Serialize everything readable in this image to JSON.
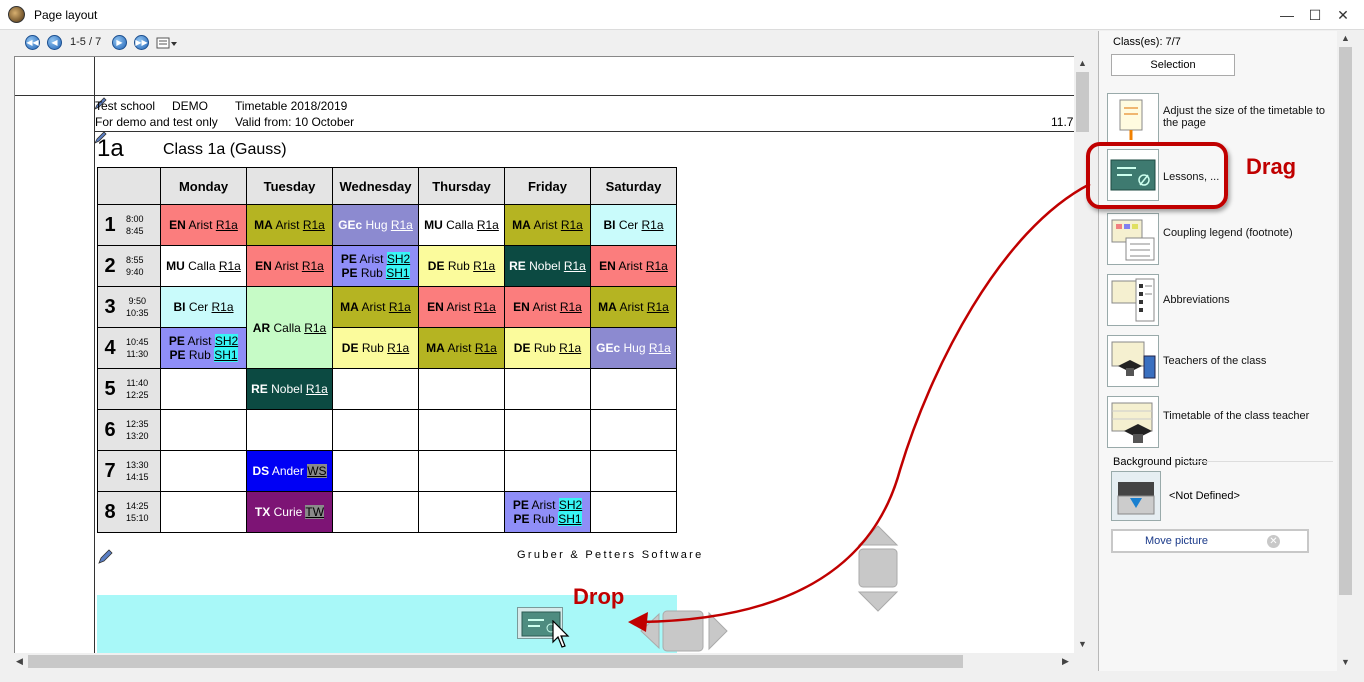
{
  "window": {
    "title": "Page layout"
  },
  "toolbar": {
    "page_info": "1-5 / 7"
  },
  "header": {
    "school": "Test school",
    "demo": "DEMO",
    "timetable": "Timetable 2018/2019",
    "note": "For demo and test only",
    "valid_from": "Valid from: 10 October",
    "right_number": "11.7"
  },
  "klass": {
    "code": "1a",
    "name": "Class 1a (Gauss)"
  },
  "days": [
    "Monday",
    "Tuesday",
    "Wednesday",
    "Thursday",
    "Friday",
    "Saturday"
  ],
  "hours": [
    {
      "n": "1",
      "t1": "8:00",
      "t2": "8:45"
    },
    {
      "n": "2",
      "t1": "8:55",
      "t2": "9:40"
    },
    {
      "n": "3",
      "t1": "9:50",
      "t2": "10:35"
    },
    {
      "n": "4",
      "t1": "10:45",
      "t2": "11:30"
    },
    {
      "n": "5",
      "t1": "11:40",
      "t2": "12:25"
    },
    {
      "n": "6",
      "t1": "12:35",
      "t2": "13:20"
    },
    {
      "n": "7",
      "t1": "13:30",
      "t2": "14:15"
    },
    {
      "n": "8",
      "t1": "14:25",
      "t2": "15:10"
    }
  ],
  "lessons": {
    "r1": [
      {
        "s": "EN",
        "t": "Arist",
        "r": "R1a"
      },
      {
        "s": "MA",
        "t": "Arist",
        "r": "R1a"
      },
      {
        "s": "GEc",
        "t": "Hug",
        "r": "R1a"
      },
      {
        "s": "MU",
        "t": "Calla",
        "r": "R1a"
      },
      {
        "s": "MA",
        "t": "Arist",
        "r": "R1a"
      },
      {
        "s": "BI",
        "t": "Cer",
        "r": "R1a"
      }
    ],
    "r2": [
      {
        "s": "MU",
        "t": "Calla",
        "r": "R1a"
      },
      {
        "s": "EN",
        "t": "Arist",
        "r": "R1a"
      },
      {
        "s": "PE",
        "t": "Arist",
        "r": "SH2",
        "s2": "PE",
        "t2": "Rub",
        "r2": "SH1"
      },
      {
        "s": "DE",
        "t": "Rub",
        "r": "R1a"
      },
      {
        "s": "RE",
        "t": "Nobel",
        "r": "R1a"
      },
      {
        "s": "EN",
        "t": "Arist",
        "r": "R1a"
      }
    ],
    "r3": [
      {
        "s": "BI",
        "t": "Cer",
        "r": "R1a"
      },
      {
        "s": "AR",
        "t": "Calla",
        "r": "R1a"
      },
      {
        "s": "MA",
        "t": "Arist",
        "r": "R1a"
      },
      {
        "s": "EN",
        "t": "Arist",
        "r": "R1a"
      },
      {
        "s": "EN",
        "t": "Arist",
        "r": "R1a"
      },
      {
        "s": "MA",
        "t": "Arist",
        "r": "R1a"
      }
    ],
    "r4": [
      {
        "s": "PE",
        "t": "Arist",
        "r": "SH2",
        "s2": "PE",
        "t2": "Rub",
        "r2": "SH1"
      },
      {
        "s": "DE",
        "t": "Rub",
        "r": "R1a"
      },
      {
        "s": "MA",
        "t": "Arist",
        "r": "R1a"
      },
      {
        "s": "DE",
        "t": "Rub",
        "r": "R1a"
      },
      {
        "s": "GEc",
        "t": "Hug",
        "r": "R1a"
      }
    ],
    "r5": [
      {
        "s": "RE",
        "t": "Nobel",
        "r": "R1a"
      }
    ],
    "r7": [
      {
        "s": "DS",
        "t": "Ander",
        "r": "WS"
      }
    ],
    "r8": [
      {
        "s": "TX",
        "t": "Curie",
        "r": "TW"
      },
      {
        "s": "PE",
        "t": "Arist",
        "r": "SH2",
        "s2": "PE",
        "t2": "Rub",
        "r2": "SH1"
      }
    ]
  },
  "footer": {
    "software": "Gruber & Petters Software"
  },
  "annotations": {
    "drag": "Drag",
    "drop": "Drop"
  },
  "rightpanel": {
    "classes": "Class(es): 7/7",
    "selection": "Selection",
    "items": [
      {
        "label": "Adjust the size of the timetable to the page"
      },
      {
        "label": "Lessons, ..."
      },
      {
        "label": "Coupling legend (footnote)"
      },
      {
        "label": "Abbreviations"
      },
      {
        "label": "Teachers of the class"
      },
      {
        "label": "Timetable of the class teacher"
      }
    ],
    "background_title": "Background picture",
    "not_defined": "<Not Defined>",
    "move_picture": "Move picture"
  },
  "colors": {
    "annotation": "#c00000",
    "accent": "#2466b8"
  }
}
